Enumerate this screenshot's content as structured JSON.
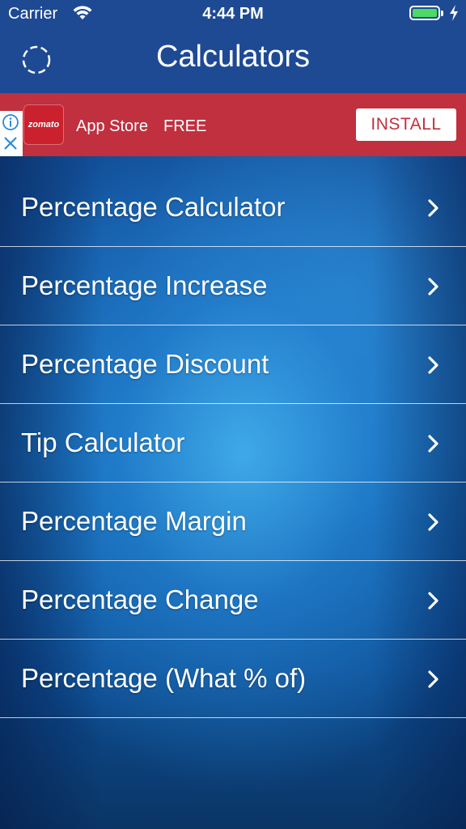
{
  "status_bar": {
    "carrier": "Carrier",
    "time": "4:44 PM",
    "battery_level": 1.0,
    "icons": [
      "wifi-icon",
      "battery-icon",
      "charging-bolt-icon"
    ]
  },
  "nav": {
    "title": "Calculators",
    "left_icon": "loading-spinner-icon"
  },
  "ad": {
    "logo_text": "zomato",
    "store": "App Store",
    "price": "FREE",
    "install_label": "INSTALL",
    "icons": [
      "info-icon",
      "close-icon"
    ],
    "background_color": "#c0303e"
  },
  "menu": {
    "items": [
      {
        "label": "Percentage Calculator"
      },
      {
        "label": "Percentage Increase"
      },
      {
        "label": "Percentage Discount"
      },
      {
        "label": "Tip Calculator"
      },
      {
        "label": "Percentage Margin"
      },
      {
        "label": "Percentage Change"
      },
      {
        "label": "Percentage (What % of)"
      }
    ],
    "item_icon": "chevron-right-icon"
  },
  "colors": {
    "header": "#1e4a94",
    "accent_text": "#ffffff",
    "battery": "#4cd964"
  }
}
